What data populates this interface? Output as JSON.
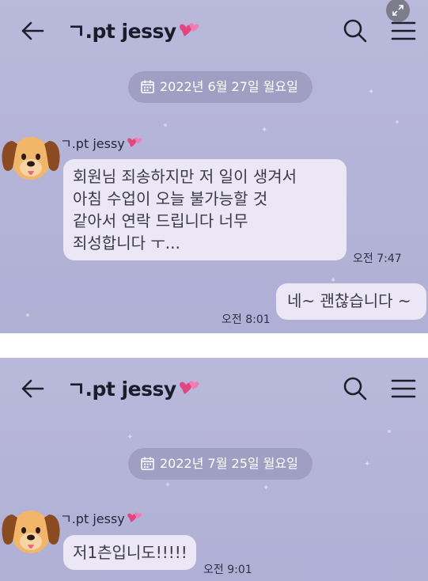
{
  "colors": {
    "background": "#b6b5da",
    "bubble": "#ece7f4",
    "date_pill": "#a09fc3",
    "heart": "#e2457f"
  },
  "screens": [
    {
      "header": {
        "back_icon": "back-arrow-icon",
        "title": "ㄱ.pt jessy",
        "title_icon": "heart-icon",
        "search_icon": "search-icon",
        "menu_icon": "menu-icon"
      },
      "date_label": "2022년 6월 27일 월요일",
      "sender_name": "ㄱ.pt jessy",
      "received": {
        "lines": [
          "회원님 죄송하지만 저 일이 생겨서",
          "아침 수업이 오늘 불가능할 것",
          "같아서 연락 드립니다 너무",
          "죄성합니다 ㅜ..."
        ],
        "time": "오전 7:47"
      },
      "sent": {
        "text": "네~ 괜찮습니다 ~",
        "time": "오전 8:01"
      }
    },
    {
      "header": {
        "back_icon": "back-arrow-icon",
        "title": "ㄱ.pt jessy",
        "title_icon": "heart-icon",
        "search_icon": "search-icon",
        "menu_icon": "menu-icon"
      },
      "date_label": "2022년 7월 25일 월요일",
      "sender_name": "ㄱ.pt jessy",
      "received": {
        "lines": [
          "저1츤입니도!!!!!"
        ],
        "time": "오전 9:01"
      }
    }
  ],
  "overlay": {
    "expand_icon": "expand-icon"
  }
}
